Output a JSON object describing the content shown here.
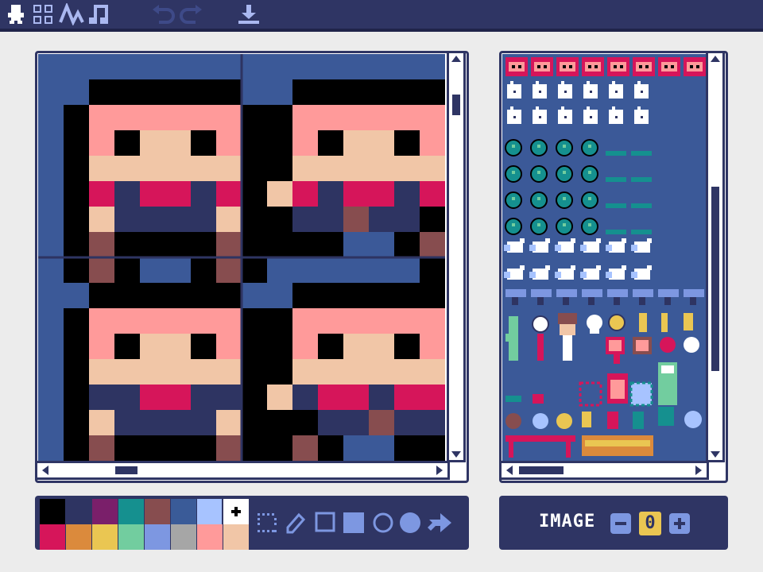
{
  "toolbar": {
    "tools": [
      {
        "name": "sprite-editor",
        "icon": "person-icon",
        "active": true
      },
      {
        "name": "map-editor",
        "icon": "grid-icon"
      },
      {
        "name": "sfx-editor",
        "icon": "waveform-icon"
      },
      {
        "name": "music-editor",
        "icon": "music-note-icon"
      }
    ],
    "undo_icon": "undo-icon",
    "redo_icon": "redo-icon",
    "save_icon": "download-icon"
  },
  "canvas": {
    "frames": 4,
    "bg_color": "#3b5998"
  },
  "palette": {
    "colors": [
      "#000000",
      "#2e3462",
      "#7a1f6a",
      "#15908f",
      "#874d4f",
      "#3a5b98",
      "#a7c3ff",
      "#ffffff",
      "#d6155a",
      "#db8a3c",
      "#eac652",
      "#72cd9f",
      "#7d97e1",
      "#a6a6a6",
      "#ff9a9a",
      "#f1c6a7"
    ],
    "selected_index": 7
  },
  "drawing_tools": [
    "select-icon",
    "pencil-icon",
    "rectangle-outline-icon",
    "rectangle-filled-icon",
    "circle-outline-icon",
    "circle-filled-icon",
    "fill-bucket-icon"
  ],
  "image_panel": {
    "label": "IMAGE",
    "value": "0"
  }
}
